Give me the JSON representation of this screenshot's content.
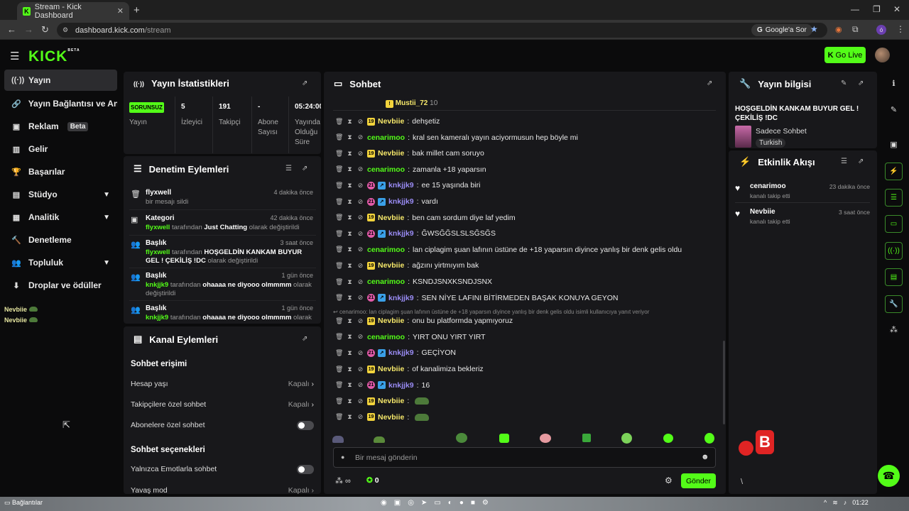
{
  "browser": {
    "tab_title": "Stream - Kick Dashboard",
    "url_host": "dashboard.kick.com",
    "url_path": "/stream",
    "google_btn": "Google'a Sor",
    "profile_letter": "ó"
  },
  "header": {
    "logo": "KICK",
    "logo_sup": "BETA",
    "go_live": "Go Live"
  },
  "sidebar": {
    "items": [
      {
        "label": "Yayın",
        "icon": "broadcast-icon"
      },
      {
        "label": "Yayın Bağlantısı ve Anahtar",
        "icon": "link-icon"
      },
      {
        "label": "Reklam",
        "icon": "ad-icon",
        "badge": "Beta"
      },
      {
        "label": "Gelir",
        "icon": "revenue-icon"
      },
      {
        "label": "Başarılar",
        "icon": "trophy-icon"
      },
      {
        "label": "Stüdyo",
        "icon": "studio-icon"
      },
      {
        "label": "Analitik",
        "icon": "analytics-icon"
      },
      {
        "label": "Denetleme",
        "icon": "moderation-icon"
      },
      {
        "label": "Topluluk",
        "icon": "community-icon"
      },
      {
        "label": "Droplar ve ödüller",
        "icon": "drops-icon"
      }
    ],
    "viewers": [
      "Nevbiie",
      "Nevbiie"
    ]
  },
  "stats": {
    "title": "Yayın İstatistikleri",
    "status_badge": "SORUNSUZ",
    "status_label": "Yayın",
    "viewers_value": "5",
    "viewers_label": "İzleyici",
    "followers_value": "191",
    "followers_label": "Takipçi",
    "subs_value": "-",
    "subs_label": "Abone Sayısı",
    "uptime_value": "05:24:00",
    "uptime_label": "Yayında Olduğu Süre"
  },
  "moderation": {
    "title": "Denetim Eylemleri",
    "items": [
      {
        "title": "flyxwell",
        "ago": "4 dakika önce",
        "line": "bir mesajı sildi"
      },
      {
        "title": "Kategori",
        "ago": "42 dakika önce",
        "user": "flyxwell",
        "mid": " tarafından ",
        "bold": "Just Chatting",
        "tail": " olarak değiştirildi"
      },
      {
        "title": "Başlık",
        "ago": "3 saat önce",
        "user": "flyxwell",
        "mid": " tarafından ",
        "bold": "HOŞGELDİN KANKAM BUYUR GEL ! ÇEKİLİŞ !DC",
        "tail": " olarak değiştirildi"
      },
      {
        "title": "Başlık",
        "ago": "1 gün önce",
        "user": "knkjjk9",
        "mid": " tarafından ",
        "bold": "ohaaaa ne diyooo olmmmm",
        "tail": " olarak değiştirildi"
      },
      {
        "title": "Başlık",
        "ago": "1 gün önce",
        "user": "knkjjk9",
        "mid": " tarafından ",
        "bold": "ohaaaa ne diyooo olmmmm",
        "tail": " olarak"
      }
    ]
  },
  "channel": {
    "title": "Kanal Eylemleri",
    "chat_access": "Sohbet erişimi",
    "account_age": "Hesap yaşı",
    "account_age_value": "Kapalı",
    "followers_only": "Takipçilere özel sohbet",
    "followers_only_value": "Kapalı",
    "subs_only": "Abonelere özel sohbet",
    "chat_options": "Sohbet seçenekleri",
    "emote_only": "Yalnızca Emotlarla sohbet",
    "slow_mode": "Yavaş mod",
    "slow_mode_value": "Kapalı"
  },
  "chat": {
    "title": "Sohbet",
    "pinned_user": "Mustii_72",
    "pinned_count": "10",
    "messages": [
      {
        "user": "Nevbiie",
        "type": "nev",
        "text": "dehşetiz"
      },
      {
        "user": "cenarimoo",
        "type": "cen",
        "text": "kral sen kameralı yayın aciyormusun hep böyle mi"
      },
      {
        "user": "Nevbiie",
        "type": "nev",
        "text": "bak millet cam soruyo"
      },
      {
        "user": "cenarimoo",
        "type": "cen",
        "text": "zamanla +18 yaparsın"
      },
      {
        "user": "knkjjk9",
        "type": "knk",
        "text": "ee 15 yaşında biri"
      },
      {
        "user": "knkjjk9",
        "type": "knk",
        "text": "vardı"
      },
      {
        "user": "Nevbiie",
        "type": "nev",
        "text": "ben cam sordum diye laf yedim"
      },
      {
        "user": "knkjjk9",
        "type": "knk",
        "text": "ĞWSĞĞSLSLSĞSĞS"
      },
      {
        "user": "cenarimoo",
        "type": "cen",
        "text": "lan ciplagim şuan lafının üstüne de +18 yaparsın diyince yanlış bir denk gelis oldu"
      },
      {
        "user": "Nevbiie",
        "type": "nev",
        "text": "ağzını yirtmıyım bak"
      },
      {
        "user": "cenarimoo",
        "type": "cen",
        "text": "KSNDJSNXKSNDJSNX"
      },
      {
        "user": "knkjjk9",
        "type": "knk",
        "text": "SEN NİYE LAFINI BİTİRMEDEN BAŞAK KONUYA GEYON"
      },
      {
        "user": "Nevbiie",
        "type": "nev",
        "text": "onu bu platformda yapmıyoruz"
      },
      {
        "user": "cenarimoo",
        "type": "cen",
        "text": "YIRT ONU YIRT YIRT"
      },
      {
        "user": "knkjjk9",
        "type": "knk",
        "text": "GEÇİYON"
      },
      {
        "user": "Nevbiie",
        "type": "nev",
        "text": "of kanalimiza bekleriz"
      },
      {
        "user": "knkjjk9",
        "type": "knk",
        "text": "16"
      },
      {
        "user": "Nevbiie",
        "type": "nev",
        "text": ""
      },
      {
        "user": "Nevbiie",
        "type": "nev",
        "text": ""
      }
    ],
    "reply_note": "cenarimoo: lan ciplagim şuan lafının üstüne de +18 yaparsın diyince yanlış bir denk gelis oldu isimli kullanıcıya yanıt veriyor",
    "input_placeholder": "Bir mesaj gönderin",
    "points": "0",
    "send": "Gönder"
  },
  "stream_info": {
    "title": "Yayın bilgisi",
    "stream_title": "HOŞGELDİN KANKAM BUYUR GEL ! ÇEKİLİŞ !DC",
    "category": "Sadece Sohbet",
    "tag": "Turkish"
  },
  "activity": {
    "title": "Etkinlik Akışı",
    "items": [
      {
        "user": "cenarimoo",
        "action": "kanalı takip etti",
        "ago": "23 dakika önce"
      },
      {
        "user": "Nevbiie",
        "action": "kanalı takip etti",
        "ago": "3 saat önce"
      }
    ]
  },
  "taskbar": {
    "bookmarks": "Bağlantılar",
    "time": "01:22"
  },
  "colors": {
    "accent": "#53fc18",
    "panel": "#18181b",
    "background": "#0b0b0c"
  }
}
